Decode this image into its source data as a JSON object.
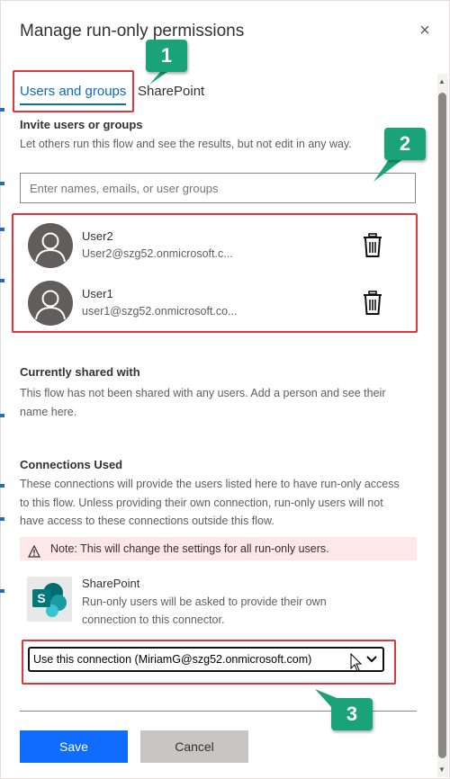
{
  "dialog": {
    "title": "Manage run-only permissions",
    "close_icon": "×"
  },
  "tabs": [
    {
      "label": "Users and groups",
      "active": true
    },
    {
      "label": "SharePoint",
      "active": false
    }
  ],
  "invite": {
    "heading": "Invite users or groups",
    "description": "Let others run this flow and see the results, but not edit in any way.",
    "placeholder": "Enter names, emails, or user groups"
  },
  "users": [
    {
      "name": "User2",
      "email": "User2@szg52.onmicrosoft.c..."
    },
    {
      "name": "User1",
      "email": "user1@szg52.onmicrosoft.co..."
    }
  ],
  "shared": {
    "heading": "Currently shared with",
    "line1": "This flow has not been shared with any users. Add a person and see their",
    "line2": "name here."
  },
  "connections": {
    "heading": "Connections Used",
    "line1": "These connections will provide the users listed here to have run-only access",
    "line2": "to this flow. Unless providing their own connection, run-only users will not",
    "line3": "have access to these connections outside this flow.",
    "warning": "Note: This will change the settings for all run-only users.",
    "connector_name": "SharePoint",
    "connector_desc1": "Run-only users will be asked to provide their own",
    "connector_desc2": "connection to this connector.",
    "selected": "Use this connection (MiriamG@szg52.onmicrosoft.com)"
  },
  "buttons": {
    "save": "Save",
    "cancel": "Cancel"
  },
  "annotations": [
    "1",
    "2",
    "3"
  ],
  "colors": {
    "accent": "#0b6ac2",
    "primary_button": "#0f6cff",
    "annotation_badge": "#1aa376",
    "highlight_box": "#e0353b",
    "warning_bg": "#fde7e9"
  }
}
